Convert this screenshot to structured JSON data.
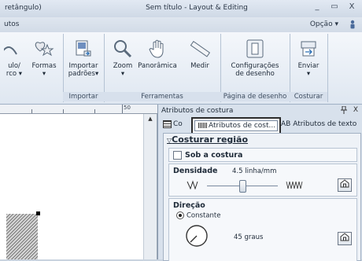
{
  "window": {
    "title": "Sem título - Layout & Editing",
    "left_fragment": "retângulo)",
    "minimize": "_",
    "maximize": "▭",
    "close": "X"
  },
  "tabs": {
    "left": "utos",
    "opcao": "Opção",
    "opcao_chevron": "▾",
    "help": "?"
  },
  "ribbon": {
    "btn_contorno_l1": "ulo/",
    "btn_contorno_l2": "rco ▾",
    "btn_formas_l1": "Formas",
    "btn_formas_l2": "▾",
    "btn_importar_l1": "Importar",
    "btn_importar_l2": "padrões▾",
    "group_importar": "Importar",
    "btn_zoom_l1": "Zoom",
    "btn_zoom_l2": "▾",
    "btn_panoramica": "Panorâmica",
    "btn_medir": "Medir",
    "group_ferramentas": "Ferramentas",
    "btn_config_l1": "Configurações",
    "btn_config_l2": "de desenho",
    "group_pagina": "Página de desenho",
    "btn_enviar_l1": "Enviar",
    "btn_enviar_l2": "▾",
    "group_costurar": "Costurar"
  },
  "ruler": {
    "label_50": "50"
  },
  "panel": {
    "title": "Atributos de costura",
    "pin": "ᵖ",
    "close": "X",
    "tab_cor": "Co",
    "tab_active": "Atributos de cost...",
    "tab_texto": "AB Atributos de texto",
    "section": "Costurar região",
    "sob_costura": "Sob a costura",
    "densidade_label": "Densidade",
    "densidade_value": "4.5 linha/mm",
    "densidade_fraction": 0.5,
    "direcao_label": "Direção",
    "constante": "Constante",
    "angle": "45 graus"
  }
}
